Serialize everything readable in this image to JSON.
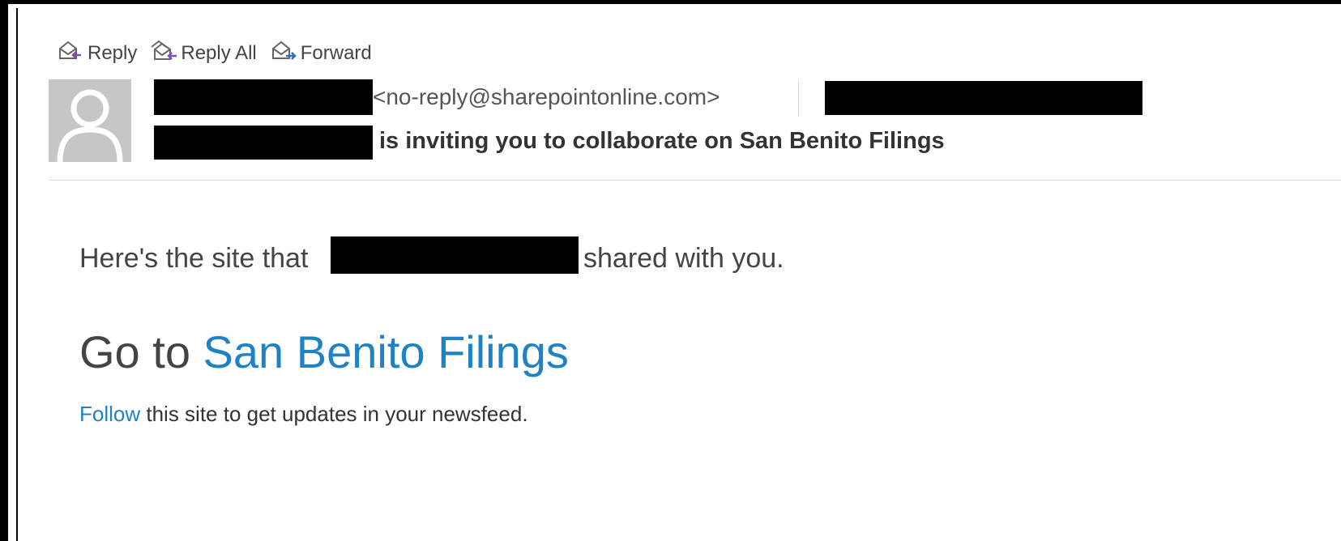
{
  "toolbar": {
    "reply_label": "Reply",
    "reply_all_label": "Reply All",
    "forward_label": "Forward"
  },
  "header": {
    "sender_email": "<no-reply@sharepointonline.com>",
    "subject_suffix": "is inviting you to collaborate on San Benito Filings"
  },
  "body": {
    "shared_prefix": "Here's the site that",
    "shared_suffix": "shared with you.",
    "goto_prefix": "Go to ",
    "site_name": "San Benito Filings",
    "follow_link": "Follow",
    "follow_suffix": " this site to get updates in your newsfeed."
  },
  "colors": {
    "link": "#1f82c4",
    "text": "#444444",
    "redaction": "#000000",
    "avatar_bg": "#c6c6c6"
  }
}
